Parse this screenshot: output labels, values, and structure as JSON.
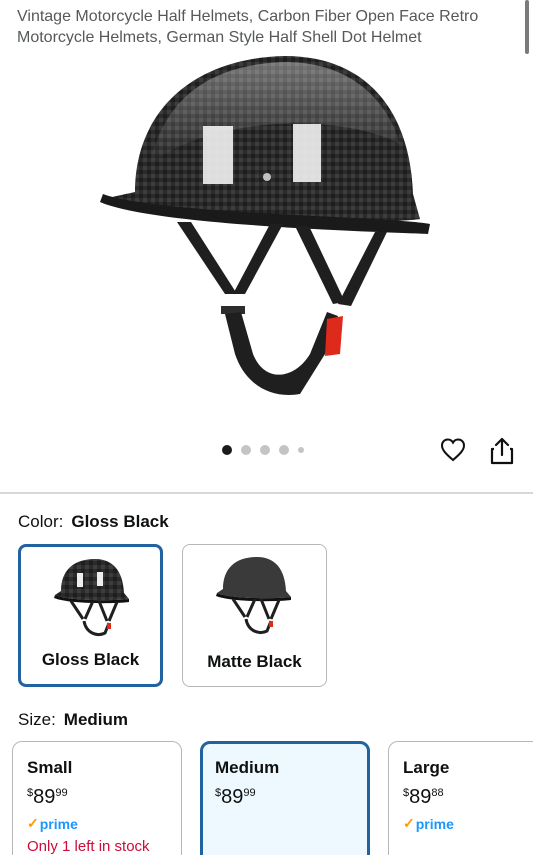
{
  "product": {
    "title": "Vintage Motorcycle Half Helmets, Carbon Fiber Open Face Retro Motorcycle Helmets, German Style Half Shell Dot Helmet"
  },
  "gallery": {
    "image_name": "carbon-fiber-helmet-image",
    "dot_count": 5,
    "active_index": 0
  },
  "actions": {
    "wishlist_icon": "heart-icon",
    "share_icon": "share-icon"
  },
  "color": {
    "label": "Color:",
    "selected": "Gloss Black",
    "options": [
      {
        "label": "Gloss Black",
        "selected": true
      },
      {
        "label": "Matte Black",
        "selected": false
      }
    ]
  },
  "size": {
    "label": "Size:",
    "selected": "Medium",
    "options": [
      {
        "label": "Small",
        "currency": "$",
        "whole": "89",
        "fraction": "99",
        "prime": "prime",
        "stock": "Only 1 left in stock"
      },
      {
        "label": "Medium",
        "currency": "$",
        "whole": "89",
        "fraction": "99",
        "prime": "",
        "stock": ""
      },
      {
        "label": "Large",
        "currency": "$",
        "whole": "89",
        "fraction": "88",
        "prime": "prime",
        "stock": ""
      }
    ]
  },
  "colors": {
    "selected_border": "#2162a1",
    "selected_bg": "#edf8ff",
    "prime_blue": "#1a98ff",
    "prime_check": "#ff9900",
    "stock_red": "#cc0c39"
  }
}
